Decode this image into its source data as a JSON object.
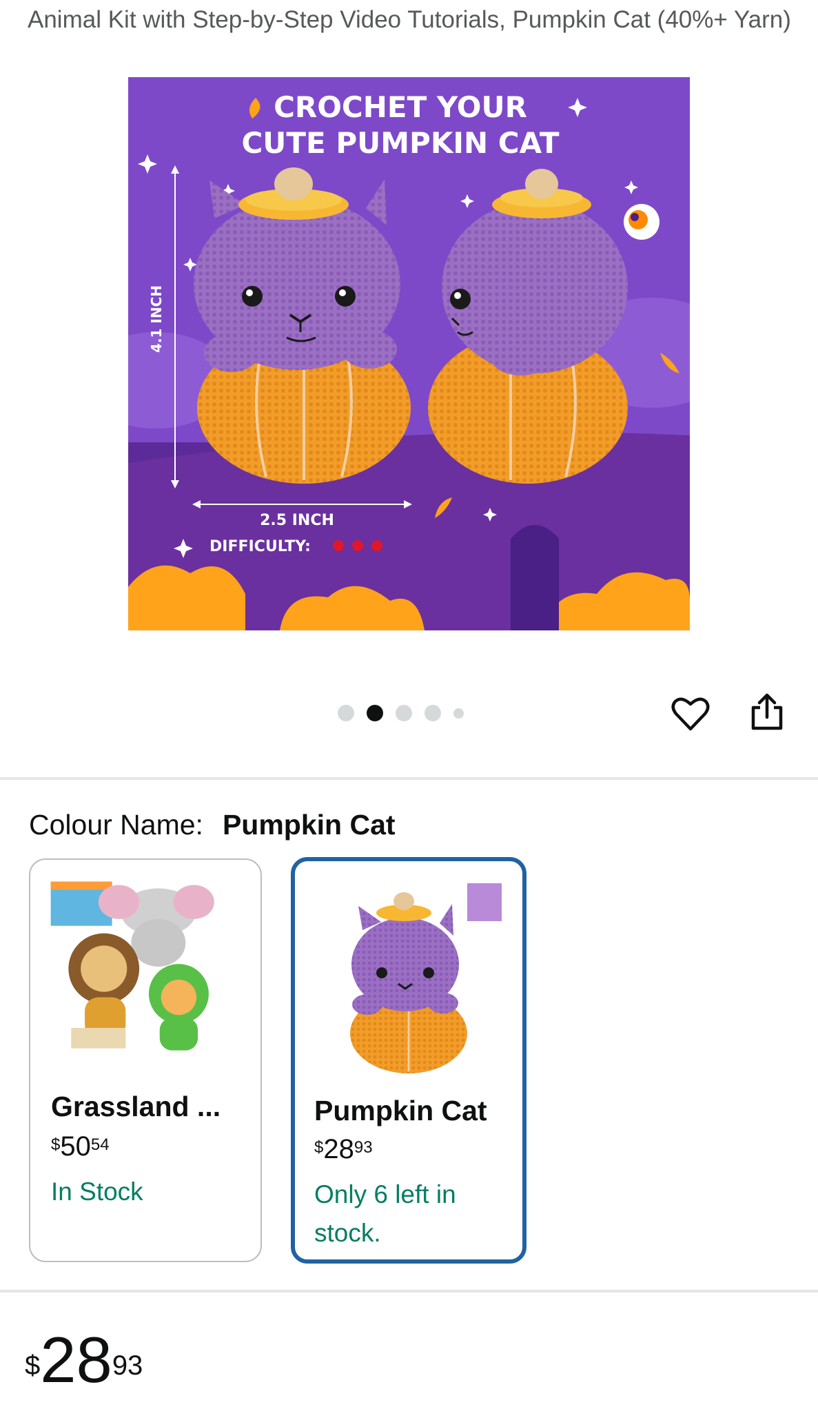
{
  "product": {
    "title": "Animal Kit with Step-by-Step Video Tutorials, Pumpkin Cat (40%+ Yarn)"
  },
  "hero_image": {
    "headline_line1": "CROCHET YOUR",
    "headline_line2": "CUTE PUMPKIN CAT",
    "height_label": "4.1 INCH",
    "width_label": "2.5 INCH",
    "difficulty_label": "DIFFICULTY:",
    "difficulty_level": 3,
    "background_color": "#7d49c9",
    "accent_color": "#ffa31a"
  },
  "carousel": {
    "total": 5,
    "active_index": 1
  },
  "actions": {
    "wishlist_icon": "heart-outline-icon",
    "share_icon": "share-icon"
  },
  "variation": {
    "label": "Colour Name:",
    "selected": "Pumpkin Cat",
    "options": [
      {
        "name": "Grassland ...",
        "price_symbol": "$",
        "price_whole": "50",
        "price_fraction": "54",
        "stock": "In Stock"
      },
      {
        "name": "Pumpkin Cat",
        "price_symbol": "$",
        "price_whole": "28",
        "price_fraction": "93",
        "stock": "Only 6 left in stock."
      }
    ]
  },
  "price": {
    "symbol": "$",
    "whole": "28",
    "fraction": "93"
  },
  "colors": {
    "selected_border": "#2162a1",
    "stock_green": "#067d62",
    "subtle_text": "#565959"
  }
}
